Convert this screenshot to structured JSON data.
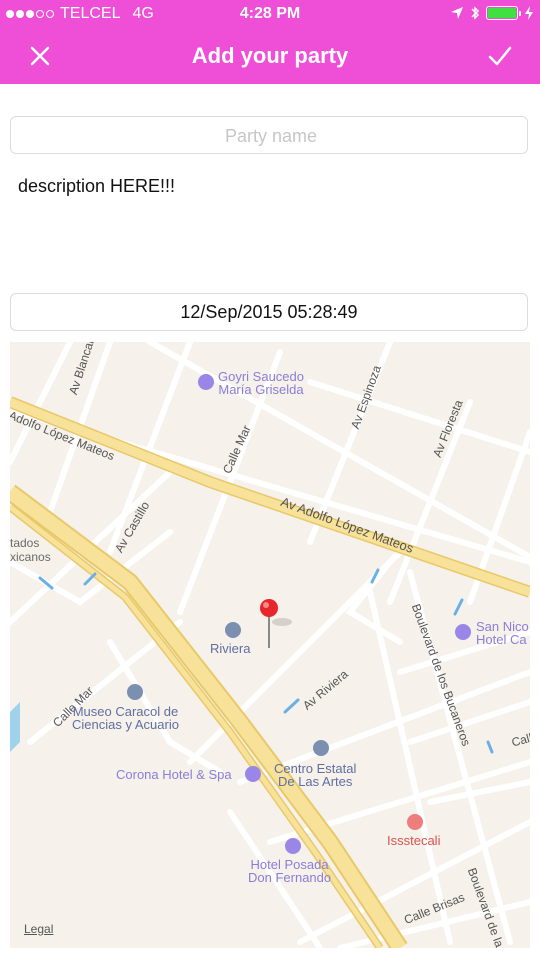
{
  "status": {
    "carrier": "TELCEL",
    "network": "4G",
    "time": "4:28 PM"
  },
  "nav": {
    "title": "Add your party",
    "close_icon": "close-icon",
    "done_icon": "checkmark-icon"
  },
  "form": {
    "party_name_placeholder": "Party name",
    "party_name_value": "",
    "description": "description HERE!!!",
    "date": "12/Sep/2015 05:28:49"
  },
  "map": {
    "roads": {
      "av_blancarte": "Av Blancarte",
      "adolfo_left": "Adolfo López Mateos",
      "av_espinoza": "Av Espinoza",
      "av_floresta": "Av Floresta",
      "calle_mar_top": "Calle Mar",
      "adolfo_main": "Av Adolfo López Mateos",
      "av_castillo": "Av Castillo",
      "av_riviera": "Av Riviera",
      "calle_mar_bottom": "Calle Mar",
      "bucaneros": "Boulevard de los Bucaneros",
      "calle_brisas": "Calle Brisas",
      "boulevard_bottom": "Boulevard de la",
      "calle_right": "Calle"
    },
    "pois": {
      "goyri": "Goyri Saucedo\nMaría Griselda",
      "riviera": "Riviera",
      "museo": "Museo Caracol de\nCiencias y Acuario",
      "centro": "Centro Estatal\nDe Las Artes",
      "corona": "Corona Hotel & Spa",
      "issstecali": "Issstecali",
      "posada": "Hotel Posada\nDon Fernando",
      "san_nico": "San Nico\nHotel Ca",
      "estados": "tados\nxicanos"
    },
    "legal": "Legal"
  },
  "colors": {
    "accent": "#ee4fd6",
    "map_bg": "#f6f1ea",
    "major_road": "#f5dc8a",
    "pin": "#e8262b"
  }
}
